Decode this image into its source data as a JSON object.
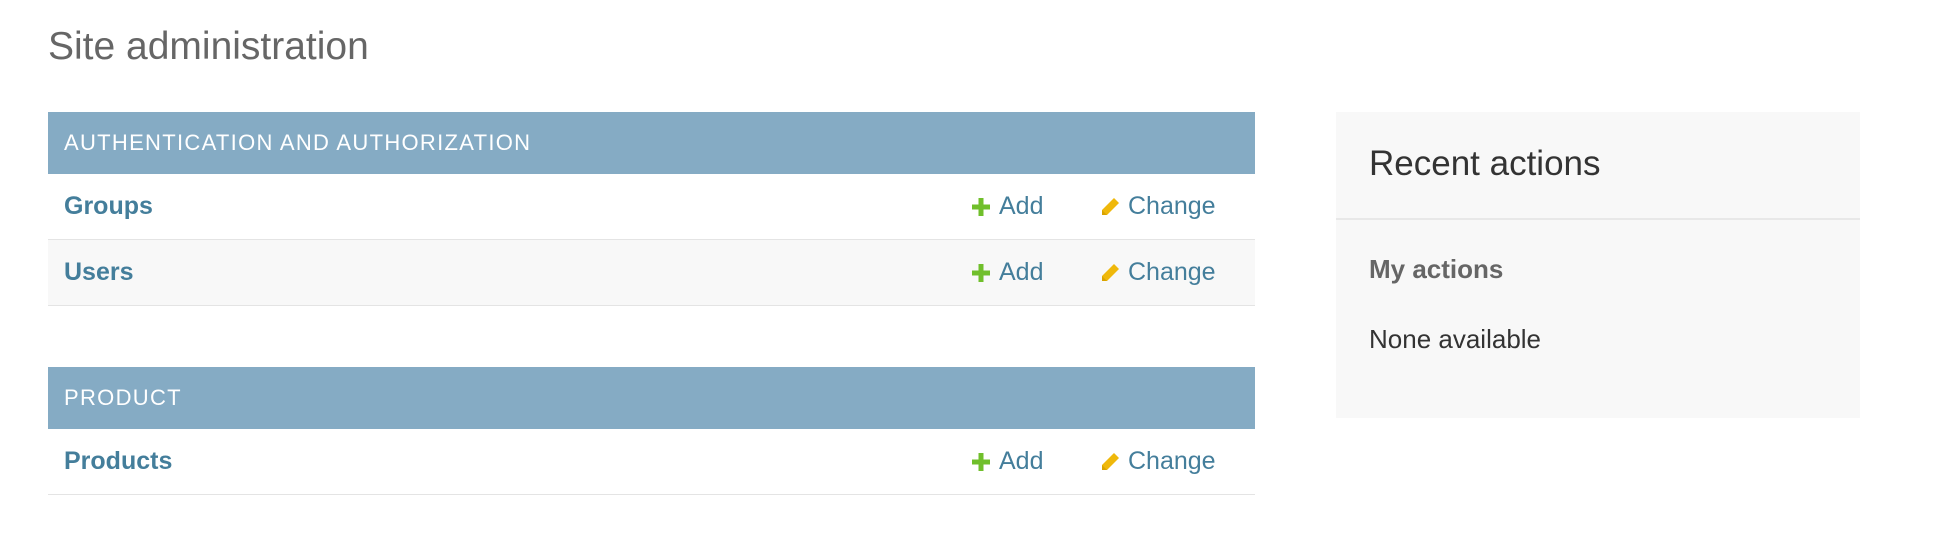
{
  "page": {
    "title": "Site administration"
  },
  "modules": [
    {
      "caption": "AUTHENTICATION AND AUTHORIZATION",
      "models": [
        {
          "name": "Groups",
          "add_label": "Add",
          "change_label": "Change"
        },
        {
          "name": "Users",
          "add_label": "Add",
          "change_label": "Change"
        }
      ]
    },
    {
      "caption": "PRODUCT",
      "models": [
        {
          "name": "Products",
          "add_label": "Add",
          "change_label": "Change"
        }
      ]
    }
  ],
  "recent_actions": {
    "title": "Recent actions",
    "subtitle": "My actions",
    "empty_text": "None available"
  },
  "icons": {
    "add": "plus-icon",
    "change": "pencil-icon"
  },
  "colors": {
    "caption_bg": "#85abc4",
    "link": "#447e9b",
    "add_icon": "#70bf2b",
    "change_icon": "#efb80b"
  }
}
